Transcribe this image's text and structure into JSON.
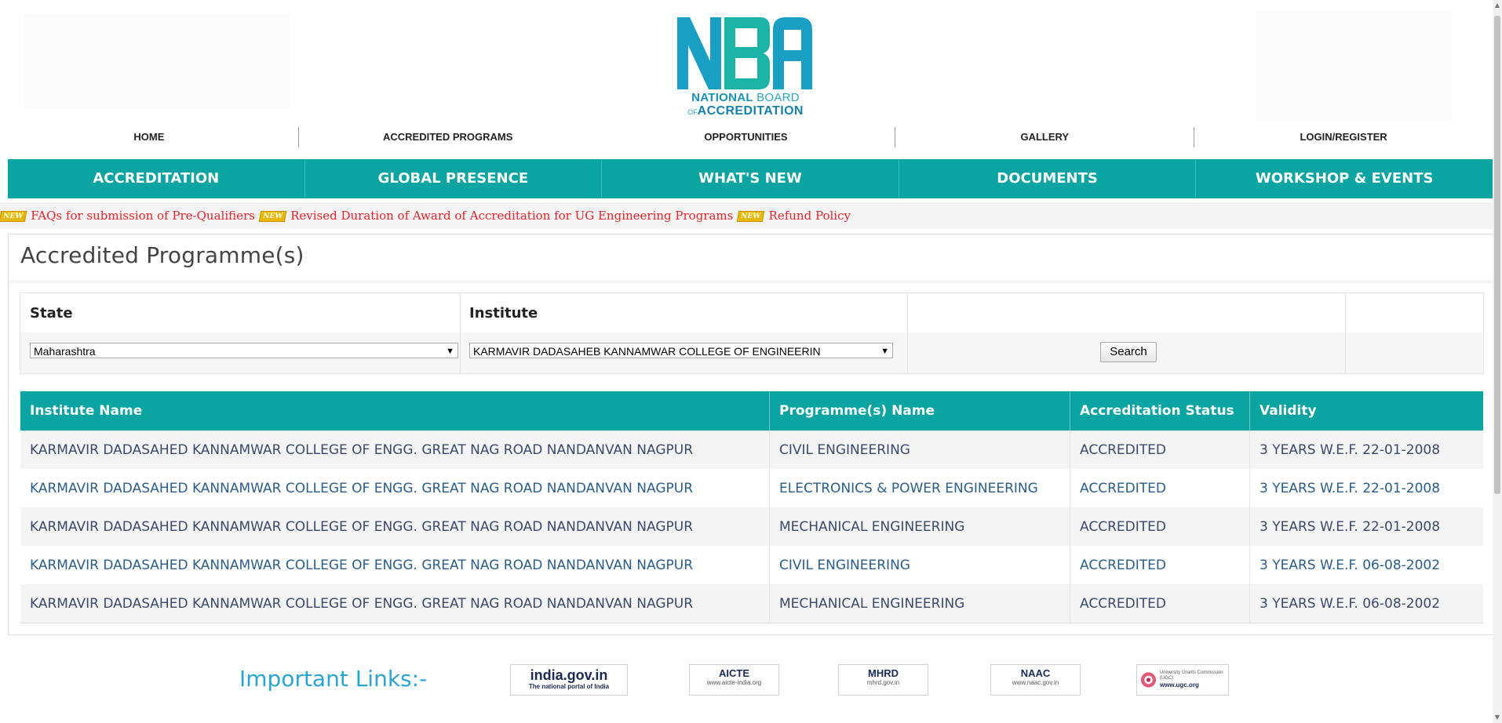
{
  "logo": {
    "line1_a": "NATIONAL",
    "line1_b": "BOARD",
    "line2_prefix": "OF",
    "line2": "ACCREDITATION",
    "colors": {
      "primary": "#1c8fb6",
      "light": "#2aa7bf"
    }
  },
  "topnav": [
    "HOME",
    "ACCREDITED PROGRAMS",
    "OPPORTUNITIES",
    "GALLERY",
    "LOGIN/REGISTER"
  ],
  "mainnav": [
    "ACCREDITATION",
    "GLOBAL PRESENCE",
    "WHAT'S NEW",
    "DOCUMENTS",
    "WORKSHOP & EVENTS"
  ],
  "ticker": {
    "items": [
      "FAQs for submission of Pre-Qualifiers",
      "Revised Duration of Award of Accreditation for UG Engineering Programs",
      "Refund Policy"
    ],
    "badge": "NEW"
  },
  "page": {
    "title": "Accredited Programme(s)"
  },
  "filter": {
    "state_label": "State",
    "institute_label": "Institute",
    "state_value": "Maharashtra",
    "institute_value": "KARMAVIR DADASAHEB KANNAMWAR COLLEGE OF ENGINEERIN",
    "search_label": "Search"
  },
  "table": {
    "headers": [
      "Institute Name",
      "Programme(s) Name",
      "Accreditation Status",
      "Validity"
    ],
    "rows": [
      [
        "KARMAVIR DADASAHED KANNAMWAR COLLEGE OF ENGG. GREAT NAG ROAD NANDANVAN NAGPUR",
        "CIVIL ENGINEERING",
        "ACCREDITED",
        "3 YEARS W.E.F. 22-01-2008"
      ],
      [
        "KARMAVIR DADASAHED KANNAMWAR COLLEGE OF ENGG. GREAT NAG ROAD NANDANVAN NAGPUR",
        "ELECTRONICS & POWER ENGINEERING",
        "ACCREDITED",
        "3 YEARS W.E.F. 22-01-2008"
      ],
      [
        "KARMAVIR DADASAHED KANNAMWAR COLLEGE OF ENGG. GREAT NAG ROAD NANDANVAN NAGPUR",
        "MECHANICAL ENGINEERING",
        "ACCREDITED",
        "3 YEARS W.E.F. 22-01-2008"
      ],
      [
        "KARMAVIR DADASAHED KANNAMWAR COLLEGE OF ENGG. GREAT NAG ROAD NANDANVAN NAGPUR",
        "CIVIL ENGINEERING",
        "ACCREDITED",
        "3 YEARS W.E.F. 06-08-2002"
      ],
      [
        "KARMAVIR DADASAHED KANNAMWAR COLLEGE OF ENGG. GREAT NAG ROAD NANDANVAN NAGPUR",
        "MECHANICAL ENGINEERING",
        "ACCREDITED",
        "3 YEARS W.E.F. 06-08-2002"
      ]
    ]
  },
  "links": {
    "title": "Important Links:-",
    "items": [
      {
        "name": "india.gov.in",
        "sub": "The national portal of India"
      },
      {
        "name": "AICTE",
        "sub": "www.aicte-india.org"
      },
      {
        "name": "MHRD",
        "sub": "mhrd.gov.in"
      },
      {
        "name": "NAAC",
        "sub": "www.naac.gov.in"
      },
      {
        "name": "University Grants Commission (UGC)",
        "sub": "www.ugc.org"
      }
    ]
  },
  "colors": {
    "teal": "#0aa4a3",
    "ticker_red": "#e8232b",
    "link_blue": "#2aa4d4"
  },
  "icons": [
    "nba-logo",
    "select-arrow-icon",
    "new-badge-icon",
    "india-gov-logo",
    "aicte-logo",
    "mhrd-emblem",
    "naac-logo",
    "ugc-logo"
  ]
}
